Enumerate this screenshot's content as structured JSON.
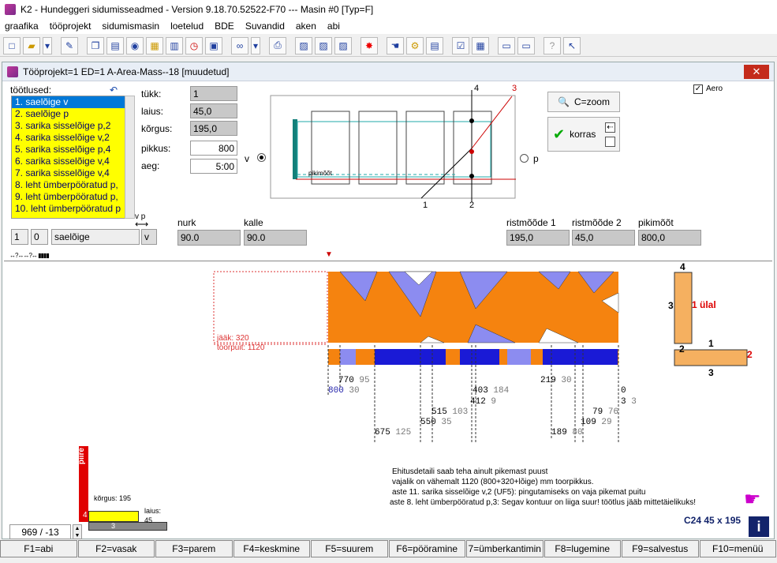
{
  "window": {
    "title": "K2 - Hundeggeri sidumisseadmed - Version 9.18.70.52522-F70  ---  Masin #0 [Typ=F]"
  },
  "menu": [
    "graafika",
    "tööprojekt",
    "sidumismasin",
    "loetelud",
    "BDE",
    "Suvandid",
    "aken",
    "abi"
  ],
  "doc": {
    "title": "Tööprojekt=1  ED=1 A-Area-Mass--18 [muudetud]",
    "close": "✕"
  },
  "ops": {
    "label": "töötlused:",
    "items": [
      "1. saelõige v",
      "2. saelõige p",
      "3. sarika sisselõige p,2",
      "4. sarika sisselõige v,2",
      "5. sarika sisselõige p,4",
      "6. sarika sisselõige v,4",
      "7. sarika sisselõige v,4",
      "8. leht ümberpööratud p,",
      "9. leht ümberpööratud p,",
      "10. leht ümberpööratud p"
    ]
  },
  "piece": {
    "tukk_label": "tükk:",
    "tukk": "1",
    "laius_label": "laius:",
    "laius": "45,0",
    "korgus_label": "kõrgus:",
    "korgus": "195,0",
    "pikkus_label": "pikkus:",
    "pikkus": "800",
    "aeg_label": "aeg:",
    "aeg": "5:00"
  },
  "opbar": {
    "num": "1",
    "side": "0",
    "name": "saelõige",
    "vp": "v",
    "vp_label": "v p",
    "nurk_label": "nurk",
    "nurk": "90.0",
    "kalle_label": "kalle",
    "kalle": "90.0"
  },
  "dims": {
    "r1_label": "ristmõõde 1",
    "r1": "195,0",
    "r2_label": "ristmõõde 2",
    "r2": "45,0",
    "pm_label": "pikimõõt",
    "pm": "800,0"
  },
  "preview": {
    "v": "v",
    "p": "p",
    "n4": "4",
    "n3": "3",
    "n1": "1",
    "n2": "2",
    "pikimoot": "pikimõõt"
  },
  "zoom": {
    "label": "C=zoom"
  },
  "ok": {
    "label": "korras"
  },
  "aero": {
    "label": "Aero"
  },
  "cut": {
    "jaak": "jääk: 320",
    "toorpuit": "toorpuit: 1120",
    "top_labels": [
      {
        "a": "770",
        "b": "95"
      },
      {
        "a": "800",
        "b": "30"
      },
      {
        "a": "403",
        "b": "184"
      },
      {
        "a": "412",
        "b": "9"
      },
      {
        "a": "515",
        "b": "103"
      },
      {
        "a": "550",
        "b": "35"
      },
      {
        "a": "675",
        "b": "125"
      },
      {
        "a": "219",
        "b": "30"
      },
      {
        "a": "0",
        "b": ""
      },
      {
        "a": "3",
        "b": "3"
      },
      {
        "a": "79",
        "b": "76"
      },
      {
        "a": "109",
        "b": "29"
      },
      {
        "a": "189",
        "b": "80"
      }
    ]
  },
  "side": {
    "n4": "4",
    "n3": "3",
    "ulal": "1 ülal",
    "n2": "2",
    "n1": "1",
    "n2b": "2",
    "n3b": "3"
  },
  "messages": [
    "Ehitusdetaili saab teha ainult pikemast puust",
    "vajalik on vähemalt 1120 (800+320+lõige) mm toorpikkus.",
    "aste 11. sarika sisselõige v,2 (UF5): pingutamiseks on vaja pikemat puitu",
    "aste  8. leht ümberpööratud p,3: Segav kontuur on liiga suur!  töötlus jääb mittetäielikuks!"
  ],
  "info": {
    "size": "C24 45 x 195"
  },
  "mini": {
    "piire": "piire",
    "korgus": "kõrgus: 195",
    "laius": "laius:",
    "laius_v": "45",
    "n4": "4",
    "n3": "3"
  },
  "coord": {
    "value": "969 / -13"
  },
  "fkeys": [
    "F1=abi",
    "F2=vasak",
    "F3=parem",
    "F4=keskmine",
    "F5=suurem",
    "F6=pööramine",
    "7=ümberkantimin",
    "F8=lugemine",
    "F9=salvestus",
    "F10=menüü"
  ],
  "colors": {
    "orange": "#f5830f",
    "blue": "#1a1ad6",
    "lightblue": "#8c8cf0",
    "yellow": "#ffff00",
    "red": "#e00000"
  }
}
